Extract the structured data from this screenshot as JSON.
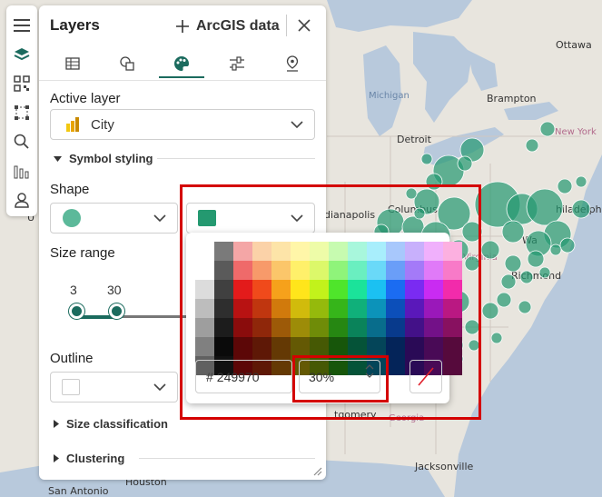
{
  "map": {
    "labels": {
      "ottawa": "Ottawa",
      "michigan": "Michigan",
      "brampton": "Brampton",
      "detroit": "Detroit",
      "new_york": "New York",
      "columbus": "Columbus",
      "philadelphia": "hiladelphi",
      "indianapolis": "dianapolis",
      "virginia": "Virginia",
      "washington": "Wa",
      "richmond": "Richmond",
      "montgomery": "tgomery",
      "georgia": "Georgia",
      "jacksonville": "Jacksonville",
      "houston": "Houston",
      "san_antonio": "San Antonio",
      "usa_fragment": "U"
    },
    "marker_color": "#249970"
  },
  "rail": {
    "icons": [
      "menu-icon",
      "layers-icon",
      "qr-code-icon",
      "select-area-icon",
      "search-icon",
      "chart-icon",
      "user-icon"
    ]
  },
  "panel": {
    "title": "Layers",
    "add_data_label": "ArcGIS data",
    "tabs": [
      "table-tab",
      "shapes-tab",
      "style-tab",
      "filter-tab",
      "location-tab"
    ],
    "active_tab": "style-tab",
    "active_layer_label": "Active layer",
    "active_layer_value": "City",
    "symbol_styling_label": "Symbol styling",
    "shape_label": "Shape",
    "shape_color": "#5cb99a",
    "fill_color": "#249970",
    "size_range_label": "Size range",
    "size_min": "3",
    "size_max": "30",
    "outline_label": "Outline",
    "outline_color": "#ffffff",
    "size_classification_label": "Size classification",
    "clustering_label": "Clustering"
  },
  "picker": {
    "hex_prefix": "#",
    "hex_value": "249970",
    "transparency_value": "30%",
    "no_color": "no-color-icon"
  }
}
